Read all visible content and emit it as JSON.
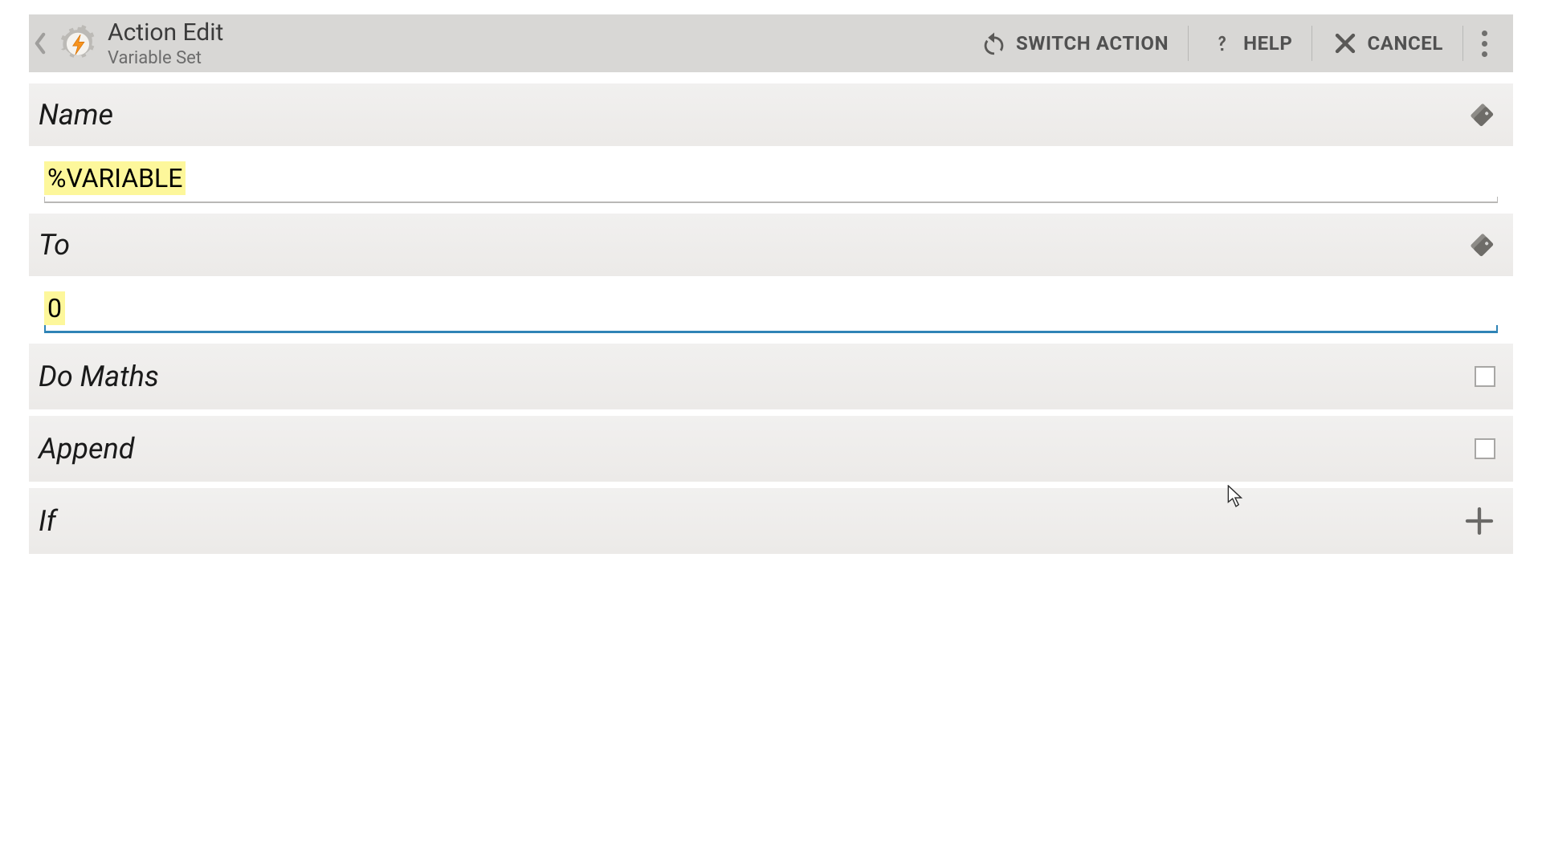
{
  "header": {
    "title": "Action Edit",
    "subtitle": "Variable Set",
    "switch_label": "SWITCH ACTION",
    "help_label": "HELP",
    "cancel_label": "CANCEL"
  },
  "fields": {
    "name": {
      "label": "Name",
      "value": "%VARIABLE"
    },
    "to": {
      "label": "To",
      "value": "0"
    },
    "do_maths": {
      "label": "Do Maths",
      "checked": false
    },
    "append": {
      "label": "Append",
      "checked": false
    },
    "if": {
      "label": "If"
    }
  },
  "colors": {
    "highlight": "#fdf79b",
    "focus_underline": "#2f84b6",
    "topbar_bg": "#d8d7d5"
  }
}
